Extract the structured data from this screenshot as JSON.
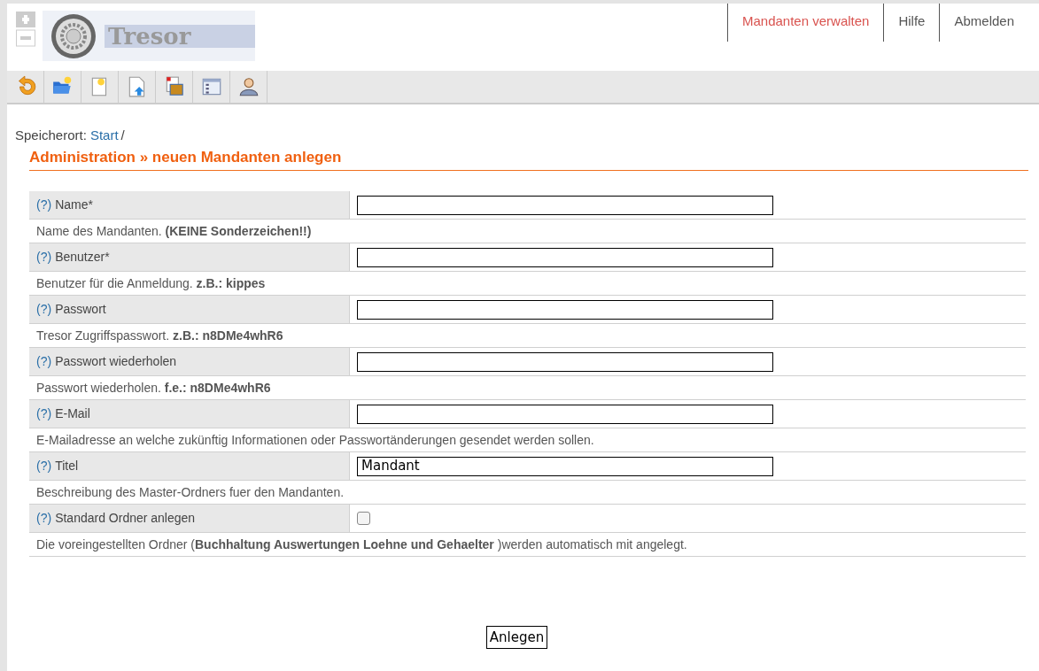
{
  "logo": {
    "text": "Tresor"
  },
  "nav": [
    {
      "label": "Mandanten verwalten",
      "selected": true
    },
    {
      "label": "Hilfe",
      "selected": false
    },
    {
      "label": "Abmelden",
      "selected": false
    }
  ],
  "breadcrumb": {
    "label": "Speicherort:",
    "link": "Start",
    "separator": "/"
  },
  "heading": "Administration » neuen Mandanten anlegen",
  "fields": [
    {
      "kind": "text",
      "help": "(?)",
      "label": "Name*",
      "description": "Name des Mandanten. **(KEINE Sonderzeichen!!)**"
    },
    {
      "kind": "text",
      "help": "(?)",
      "label": "Benutzer*",
      "description": "Benutzer für die Anmeldung. **z.B.: kippes**"
    },
    {
      "kind": "text",
      "help": "(?)",
      "label": "Passwort",
      "description": "Tresor Zugriffspasswort. **z.B.: n8DMe4whR6**"
    },
    {
      "kind": "text",
      "help": "(?)",
      "label": "Passwort wiederholen",
      "description": "Passwort wiederholen. **f.e.: n8DMe4whR6**"
    },
    {
      "kind": "text",
      "help": "(?)",
      "label": "E-Mail",
      "description": "E-Mailadresse an welche zukünftig Informationen oder Passwortänderungen gesendet werden sollen."
    },
    {
      "kind": "text",
      "help": "(?)",
      "label": "Titel",
      "value": "Mandant",
      "description": "Beschreibung des Master-Ordners fuer den Mandanten."
    },
    {
      "kind": "checkbox",
      "help": "(?)",
      "label": "Standard Ordner anlegen",
      "checked": false,
      "description": "Die voreingestellten Ordner (**Buchhaltung Auswertungen Loehne und Gehaelter** )werden automatisch mit angelegt."
    }
  ],
  "submit": "Anlegen"
}
